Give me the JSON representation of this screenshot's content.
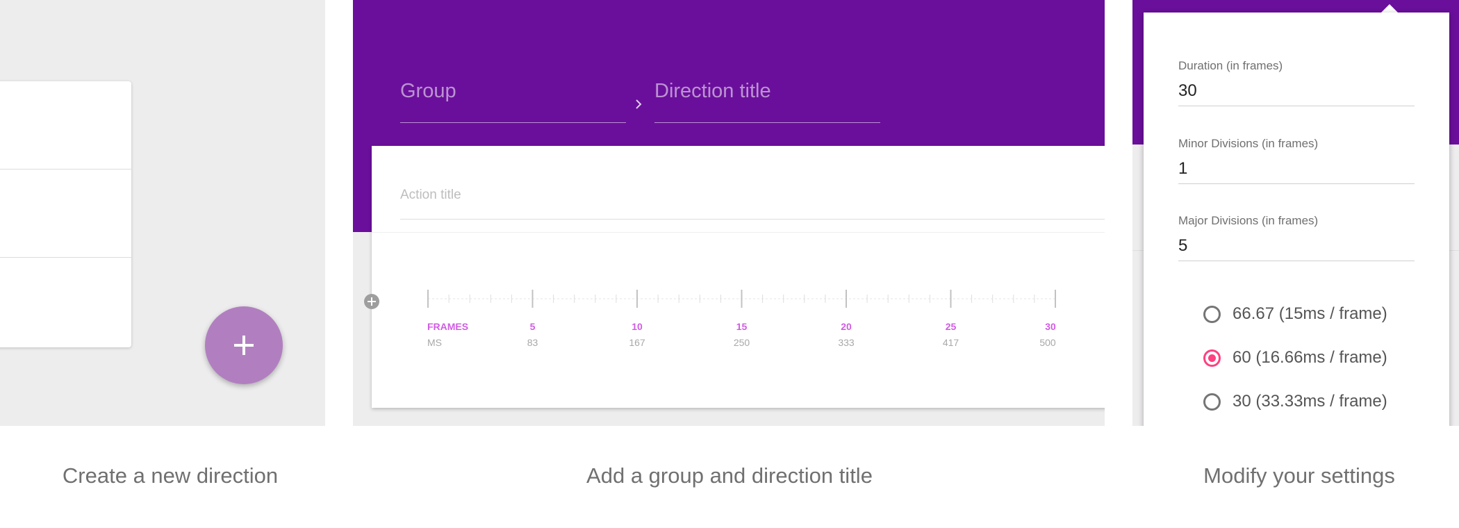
{
  "panel1": {
    "list_rows": 3,
    "fab_icon": "plus-icon",
    "fab_color": "#b17fc0"
  },
  "panel2": {
    "header_color": "#6a0f9b",
    "group_placeholder": "Group",
    "direction_title_placeholder": "Direction title",
    "action_title_placeholder": "Action title",
    "timeline": {
      "frames_label": "FRAMES",
      "ms_label": "MS",
      "frame_ticks": [
        "5",
        "10",
        "15",
        "20",
        "25",
        "30"
      ],
      "ms_ticks": [
        "83",
        "167",
        "250",
        "333",
        "417",
        "500"
      ],
      "frame_label_color": "#d05ce3"
    }
  },
  "panel3": {
    "settings": [
      {
        "label": "Duration (in frames)",
        "value": "30"
      },
      {
        "label": "Minor Divisions (in frames)",
        "value": "1"
      },
      {
        "label": "Major Divisions (in frames)",
        "value": "5"
      }
    ],
    "fps_options": [
      {
        "label": "66.67 (15ms / frame)",
        "selected": false
      },
      {
        "label": "60 (16.66ms / frame)",
        "selected": true
      },
      {
        "label": "30 (33.33ms / frame)",
        "selected": false
      }
    ],
    "accent_color": "#ff4081"
  },
  "captions": {
    "step1": "Create a new direction",
    "step2": "Add a group and direction title",
    "step3": "Modify your settings"
  }
}
